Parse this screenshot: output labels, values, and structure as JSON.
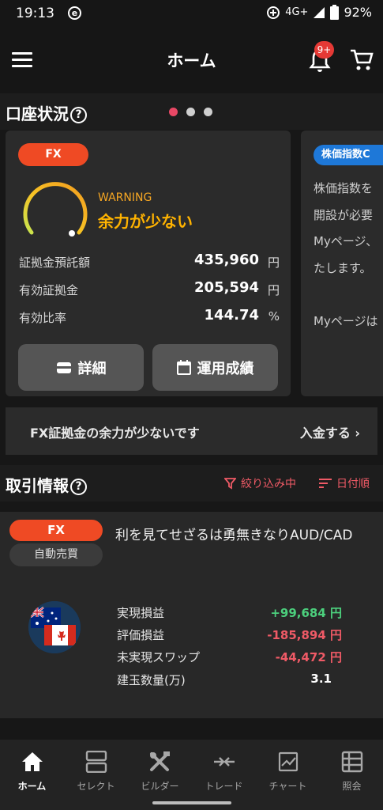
{
  "status_bar": {
    "time": "19:13",
    "network": "4G+",
    "battery": "92%"
  },
  "app_bar": {
    "title": "ホーム",
    "notification_badge": "9+"
  },
  "account_section": {
    "title": "口座状況",
    "fx_card": {
      "tag": "FX",
      "warning_label": "WARNING",
      "warning_text": "余力が少ない",
      "metrics": [
        {
          "label": "証拠金預託額",
          "value": "435,960",
          "unit": "円"
        },
        {
          "label": "有効証拠金",
          "value": "205,594",
          "unit": "円"
        },
        {
          "label": "有効比率",
          "value": "144.74",
          "unit": "%"
        }
      ],
      "details_button": "詳細",
      "performance_button": "運用成績"
    },
    "index_card": {
      "tag": "株価指数C",
      "lines": [
        "株価指数を",
        "開設が必要",
        "Myページ、",
        "たします。",
        "Myページは"
      ]
    }
  },
  "banner": {
    "message": "FX証拠金の余力が少ないです",
    "action": "入金する"
  },
  "trade_section": {
    "title": "取引情報",
    "filter_label": "絞り込み中",
    "sort_label": "日付順",
    "trade": {
      "tag": "FX",
      "mode": "自動売買",
      "strategy": "利を見てせざるは勇無きなりAUD/CAD",
      "rows": [
        {
          "label": "実現損益",
          "value": "+99,684 円",
          "color": "#4cd07d"
        },
        {
          "label": "評価損益",
          "value": "-185,894 円",
          "color": "#ef5a66"
        },
        {
          "label": "未実現スワップ",
          "value": "-44,472 円",
          "color": "#ef5a66"
        },
        {
          "label": "建玉数量(万)",
          "value": "3.1",
          "color": "#ffffff"
        }
      ]
    }
  },
  "bottom_nav": [
    {
      "label": "ホーム",
      "icon": "home-icon",
      "active": true
    },
    {
      "label": "セレクト",
      "icon": "select-icon",
      "active": false
    },
    {
      "label": "ビルダー",
      "icon": "tools-icon",
      "active": false
    },
    {
      "label": "トレード",
      "icon": "trade-icon",
      "active": false
    },
    {
      "label": "チャート",
      "icon": "chart-icon",
      "active": false
    },
    {
      "label": "照会",
      "icon": "list-icon",
      "active": false
    }
  ]
}
